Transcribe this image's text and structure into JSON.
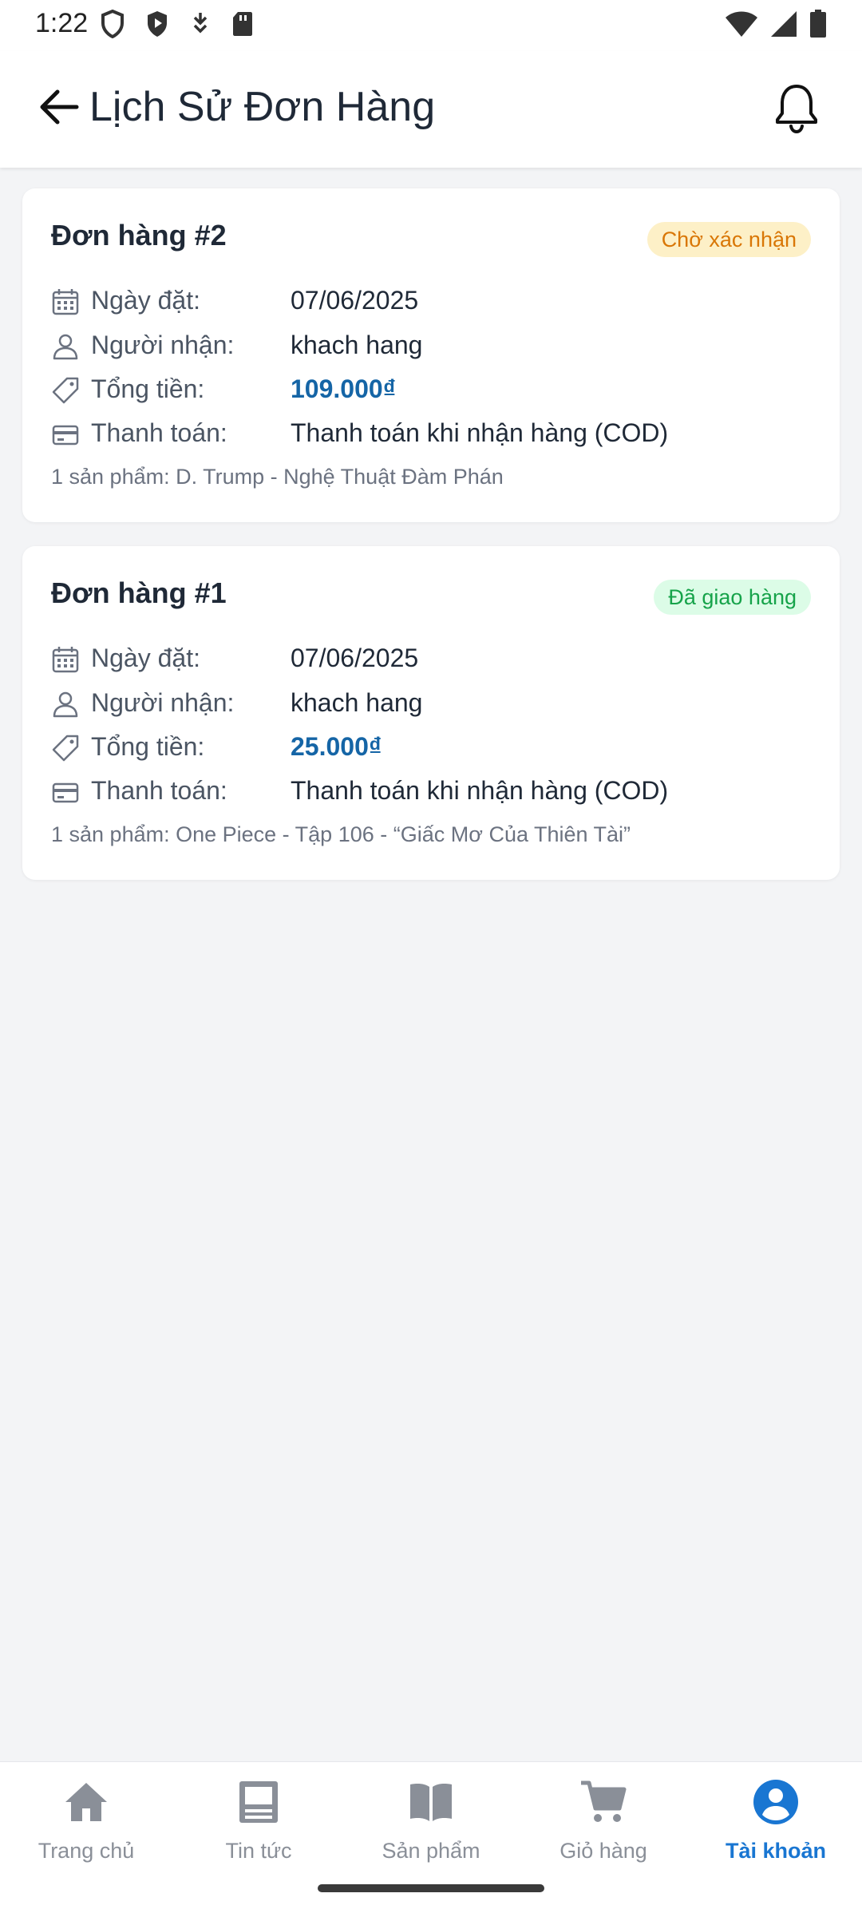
{
  "status_bar": {
    "time": "1:22"
  },
  "header": {
    "title": "Lịch Sử Đơn Hàng"
  },
  "orders": [
    {
      "title": "Đơn hàng #2",
      "status": "Chờ xác nhận",
      "date_label": "Ngày đặt:",
      "date": "07/06/2025",
      "recipient_label": "Người nhận:",
      "recipient": "khach hang",
      "total_label": "Tổng tiền:",
      "total": "109.000₫",
      "payment_label": "Thanh toán:",
      "payment": "Thanh toán khi nhận hàng (COD)",
      "products": "1 sản phẩm: D. Trump - Nghệ Thuật Đàm Phán"
    },
    {
      "title": "Đơn hàng #1",
      "status": "Đã giao hàng",
      "date_label": "Ngày đặt:",
      "date": "07/06/2025",
      "recipient_label": "Người nhận:",
      "recipient": "khach hang",
      "total_label": "Tổng tiền:",
      "total": "25.000₫",
      "payment_label": "Thanh toán:",
      "payment": "Thanh toán khi nhận hàng (COD)",
      "products": "1 sản phẩm: One Piece - Tập 106 - “Giấc Mơ Của Thiên Tài”"
    }
  ],
  "bottom_nav": [
    {
      "label": "Trang chủ",
      "icon": "home-icon"
    },
    {
      "label": "Tin tức",
      "icon": "news-icon"
    },
    {
      "label": "Sản phẩm",
      "icon": "book-icon"
    },
    {
      "label": "Giỏ hàng",
      "icon": "cart-icon"
    },
    {
      "label": "Tài khoản",
      "icon": "account-icon",
      "active": true
    }
  ],
  "colors": {
    "accent": "#1976d2",
    "price": "#1565a6",
    "pending_bg": "#fdf0c7",
    "pending_text": "#d97706",
    "done_bg": "#dcfce7",
    "done_text": "#16a34a"
  }
}
